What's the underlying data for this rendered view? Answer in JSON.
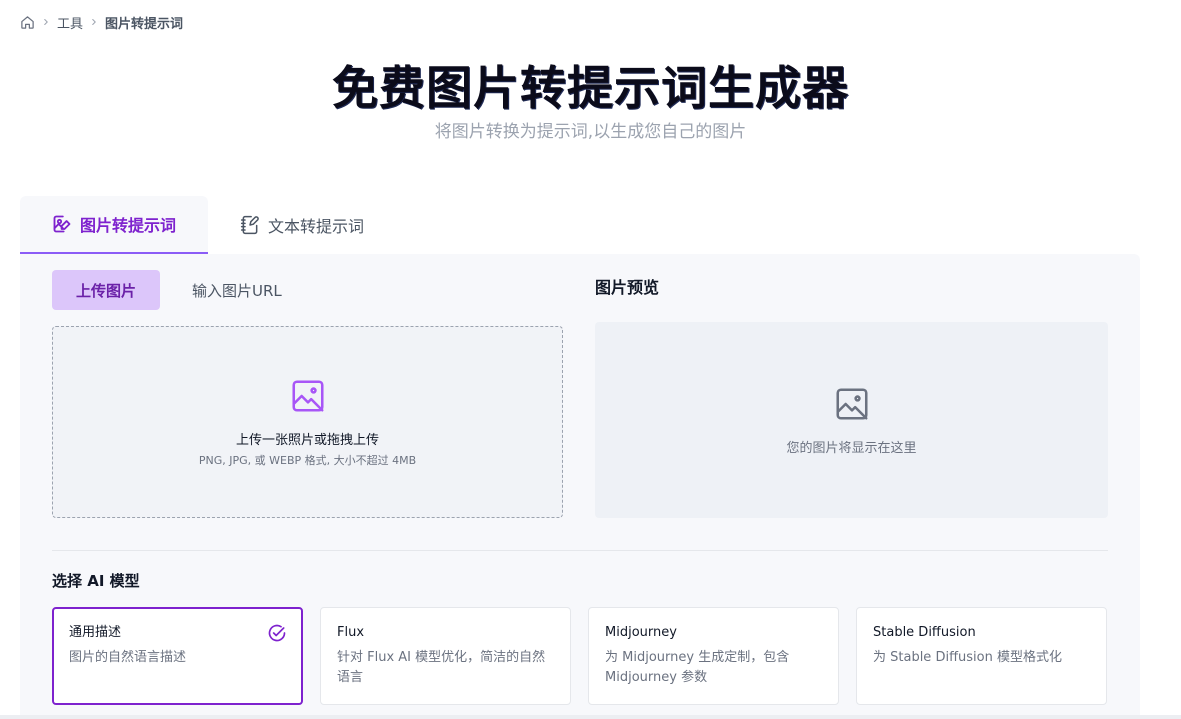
{
  "breadcrumb": {
    "home_icon": "home-icon",
    "items": [
      "工具",
      "图片转提示词"
    ]
  },
  "hero": {
    "title": "免费图片转提示词生成器",
    "subtitle": "将图片转换为提示词,以生成您自己的图片"
  },
  "tabs": [
    {
      "label": "图片转提示词",
      "icon": "image-edit-icon",
      "active": true
    },
    {
      "label": "文本转提示词",
      "icon": "notebook-pen-icon",
      "active": false
    }
  ],
  "upload": {
    "subtabs": [
      {
        "label": "上传图片",
        "active": true
      },
      {
        "label": "输入图片URL",
        "active": false
      }
    ],
    "dropzone_text": "上传一张照片或拖拽上传",
    "dropzone_hint": "PNG, JPG, 或 WEBP 格式, 大小不超过 4MB"
  },
  "preview": {
    "title": "图片预览",
    "placeholder": "您的图片将显示在这里"
  },
  "models": {
    "title": "选择 AI 模型",
    "items": [
      {
        "name": "通用描述",
        "desc": "图片的自然语言描述",
        "selected": true
      },
      {
        "name": "Flux",
        "desc": "针对 Flux AI 模型优化，简洁的自然语言",
        "selected": false
      },
      {
        "name": "Midjourney",
        "desc": "为 Midjourney 生成定制，包含 Midjourney 参数",
        "selected": false
      },
      {
        "name": "Stable Diffusion",
        "desc": "为 Stable Diffusion 模型格式化",
        "selected": false
      }
    ]
  },
  "colors": {
    "accent": "#7e22ce",
    "accent_light": "#dcc6fa",
    "panel_bg": "#f7f8fb"
  }
}
